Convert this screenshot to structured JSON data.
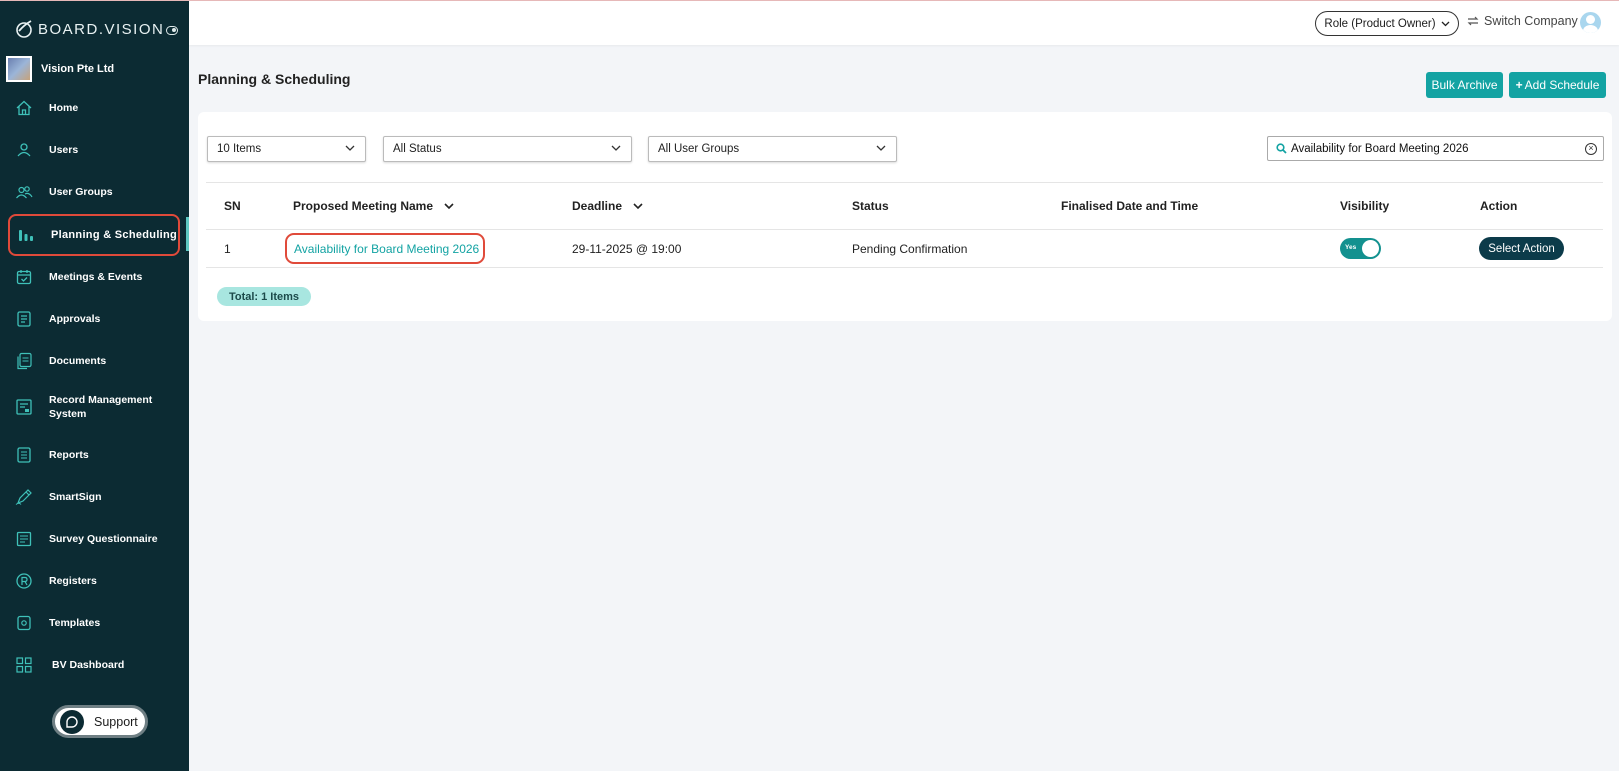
{
  "brand": {
    "name": "BOARD.VISION"
  },
  "company": {
    "name": "Vision Pte Ltd"
  },
  "sidebar": {
    "items": [
      {
        "label": "Home",
        "icon": "home-icon"
      },
      {
        "label": "Users",
        "icon": "user-icon"
      },
      {
        "label": "User Groups",
        "icon": "users-icon"
      },
      {
        "label": "Planning & Scheduling",
        "icon": "bar-chart-icon",
        "active": true
      },
      {
        "label": "Meetings & Events",
        "icon": "calendar-icon"
      },
      {
        "label": "Approvals",
        "icon": "document-check-icon"
      },
      {
        "label": "Documents",
        "icon": "documents-icon"
      },
      {
        "label": "Record Management System",
        "icon": "record-icon"
      },
      {
        "label": "Reports",
        "icon": "report-icon"
      },
      {
        "label": "SmartSign",
        "icon": "pen-icon"
      },
      {
        "label": "Survey Questionnaire",
        "icon": "survey-icon"
      },
      {
        "label": "Registers",
        "icon": "registered-icon"
      },
      {
        "label": "Templates",
        "icon": "template-icon"
      },
      {
        "label": "BV Dashboard",
        "icon": "dashboard-grid-icon"
      }
    ],
    "support_label": "Support"
  },
  "topbar": {
    "role_label": "Role (Product Owner)",
    "switch_company_label": "Switch Company"
  },
  "page": {
    "title": "Planning & Scheduling",
    "bulk_archive_label": "Bulk Archive",
    "add_schedule_label": "Add Schedule"
  },
  "filters": {
    "items_per_page": "10 Items",
    "status": "All Status",
    "user_groups": "All User Groups",
    "search_value": "Availability for Board Meeting 2026"
  },
  "table": {
    "headers": {
      "sn": "SN",
      "name": "Proposed Meeting Name",
      "deadline": "Deadline",
      "status": "Status",
      "finalised": "Finalised Date and Time",
      "visibility": "Visibility",
      "action": "Action"
    },
    "rows": [
      {
        "sn": "1",
        "name": "Availability for Board Meeting 2026",
        "deadline": "29-11-2025 @ 19:00",
        "status": "Pending Confirmation",
        "finalised": "",
        "visibility_label": "Yes",
        "visibility_on": true,
        "action_label": "Select Action"
      }
    ],
    "total_label": "Total: 1 Items"
  },
  "colors": {
    "sidebar_bg": "#0c2b33",
    "accent": "#13a3a3",
    "highlight_outline": "#e04a3a"
  }
}
